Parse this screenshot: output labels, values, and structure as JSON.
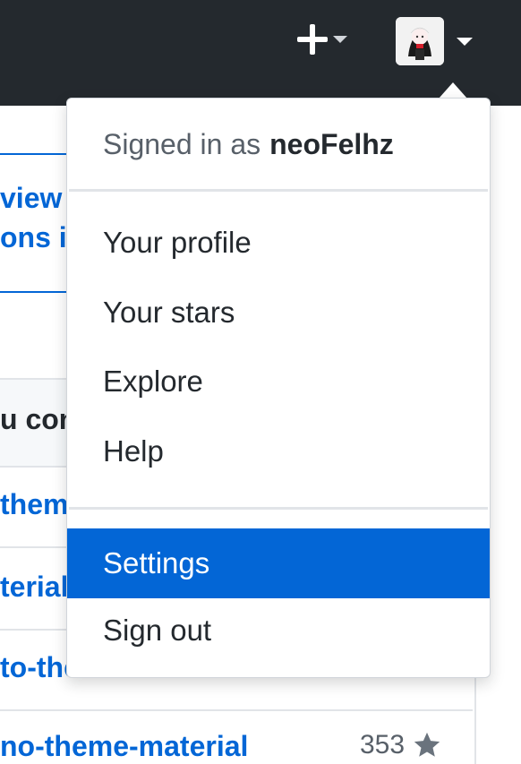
{
  "header": {
    "plus_icon": "plus-icon",
    "caret_icon": "caret-down-icon",
    "avatar": "user-avatar"
  },
  "background": {
    "link_line_1": "view",
    "link_line_2": "ons i",
    "list_header": "u con",
    "rows": [
      "them",
      "terial",
      "to-the",
      "no-theme-material"
    ],
    "star_count": "353",
    "star_icon": "star-icon"
  },
  "menu": {
    "signed_in_prefix": "Signed in as",
    "username": "neoFelhz",
    "items": [
      {
        "label": "Your profile"
      },
      {
        "label": "Your stars"
      },
      {
        "label": "Explore"
      },
      {
        "label": "Help"
      },
      {
        "label": "Settings",
        "active": true
      },
      {
        "label": "Sign out"
      }
    ]
  },
  "colors": {
    "header_bg": "#24292e",
    "accent": "#0366d6",
    "text": "#24292e",
    "muted": "#586069"
  }
}
